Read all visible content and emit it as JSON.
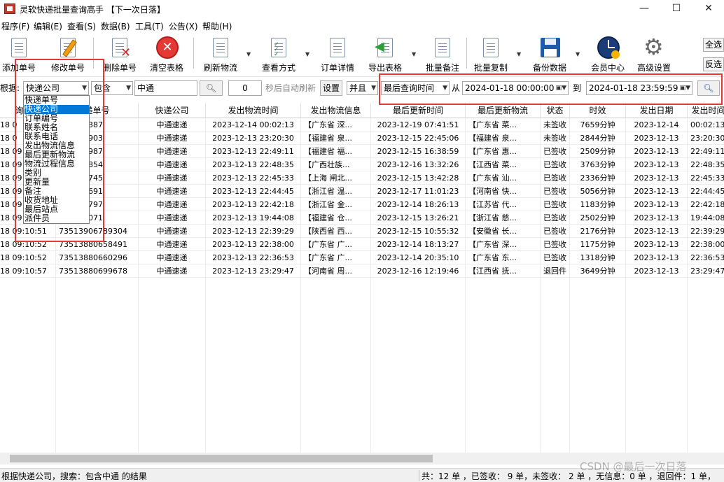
{
  "window": {
    "title": "灵软快递批量查询高手 【下一次日落】",
    "min_glyph": "—",
    "max_glyph": "☐",
    "close_glyph": "✕"
  },
  "menu": [
    "程序(F)",
    "编辑(E)",
    "查看(S)",
    "数据(B)",
    "工具(T)",
    "公告(X)",
    "帮助(H)"
  ],
  "toolbar": {
    "add": "添加单号",
    "edit": "修改单号",
    "delete": "删除单号",
    "clear": "清空表格",
    "refresh": "刷新物流",
    "view_mode": "查看方式",
    "order_detail": "订单详情",
    "export": "导出表格",
    "batch_note": "批量备注",
    "batch_copy": "批量复制",
    "backup": "备份数据",
    "member": "会员中心",
    "advanced": "高级设置",
    "select_all": "全选",
    "invert": "反选"
  },
  "filter": {
    "by_label": "根据:",
    "field_value": "快递公司",
    "op_value": "包含",
    "search_value": "中通",
    "search_icon": "magnifier-icon",
    "refresh_seconds": "0",
    "auto_refresh_label": "秒后自动刷新",
    "settings_label": "设置",
    "and_value": "并且",
    "time_field_value": "最后查询时间",
    "from_label": "从",
    "from_value": "2024-01-18 00:00:00",
    "to_label": "到",
    "to_value": "2024-01-18 23:59:59"
  },
  "dropdown_options": [
    "快递单号",
    "快递公司",
    "订单编号",
    "联系姓名",
    "联系电话",
    "发出物流信息",
    "最后更新物流",
    "物流过程信息",
    "类别",
    "更新量",
    "备注",
    "收货地址",
    "最后站点",
    "派件员"
  ],
  "dropdown_selected": 1,
  "columns": [
    "询时间",
    "递单号",
    "快递公司",
    "发出物流时间",
    "发出物流信息",
    "最后更新时间",
    "最后更新物流",
    "状态",
    "时效",
    "发出日期",
    "发出时间"
  ],
  "rows": [
    [
      "18 0",
      "880635387",
      "中通速递",
      "2023-12-14 00:02:13",
      "【广东省 深...",
      "2023-12-19 07:41:51",
      "【广东省 菜...",
      "未签收",
      "7659分钟",
      "2023-12-14",
      "00:02:13"
    ],
    [
      "18 0",
      "880671903",
      "中通速递",
      "2023-12-13 23:20:30",
      "【福建省 泉...",
      "2023-12-15 22:45:06",
      "【福建省 泉...",
      "未签收",
      "2844分钟",
      "2023-12-13",
      "23:20:30"
    ],
    [
      "18 09",
      "880676987",
      "中通速递",
      "2023-12-13 22:49:11",
      "【福建省 福...",
      "2023-12-15 16:38:59",
      "【广东省 惠...",
      "已签收",
      "2509分钟",
      "2023-12-13",
      "22:49:11"
    ],
    [
      "18 09",
      "906024854",
      "中通速递",
      "2023-12-13 22:48:35",
      "【广西壮族...",
      "2023-12-16 13:32:26",
      "【江西省 菜...",
      "已签收",
      "3763分钟",
      "2023-12-13",
      "22:48:35"
    ],
    [
      "18 09",
      "880689745",
      "中通速递",
      "2023-12-13 22:45:33",
      "【上海 闸北...",
      "2023-12-15 13:42:28",
      "【广东省 汕...",
      "已签收",
      "2336分钟",
      "2023-12-13",
      "22:45:33"
    ],
    [
      "18 09",
      "880694691",
      "中通速递",
      "2023-12-13 22:44:45",
      "【浙江省 温...",
      "2023-12-17 11:01:23",
      "【河南省 快...",
      "已签收",
      "5056分钟",
      "2023-12-13",
      "22:44:45"
    ],
    [
      "18 09",
      "906764797",
      "中通速递",
      "2023-12-13 22:42:18",
      "【浙江省 金...",
      "2023-12-14 18:26:13",
      "【江苏省 代...",
      "已签收",
      "1183分钟",
      "2023-12-13",
      "22:42:18"
    ],
    [
      "18 09",
      "880651071",
      "中通速递",
      "2023-12-13 19:44:08",
      "【福建省 仓...",
      "2023-12-15 13:26:21",
      "【浙江省 慈...",
      "已签收",
      "2502分钟",
      "2023-12-13",
      "19:44:08"
    ],
    [
      "18 09:10:51",
      "73513906789304",
      "中通速递",
      "2023-12-13 22:39:29",
      "【陕西省 西...",
      "2023-12-15 10:55:32",
      "【安徽省 长...",
      "已签收",
      "2176分钟",
      "2023-12-13",
      "22:39:29"
    ],
    [
      "18 09:10:52",
      "73513880658491",
      "中通速递",
      "2023-12-13 22:38:00",
      "【广东省 广...",
      "2023-12-14 18:13:27",
      "【广东省 深...",
      "已签收",
      "1175分钟",
      "2023-12-13",
      "22:38:00"
    ],
    [
      "18 09:10:52",
      "73513880660296",
      "中通速递",
      "2023-12-13 22:36:53",
      "【广东省 广...",
      "2023-12-14 20:35:10",
      "【广东省 东...",
      "已签收",
      "1318分钟",
      "2023-12-13",
      "22:36:53"
    ],
    [
      "18 09:10:57",
      "73513880699678",
      "中通速递",
      "2023-12-13 23:29:47",
      "【河南省 周...",
      "2023-12-16 12:19:46",
      "【江西省 抚...",
      "退回件",
      "3649分钟",
      "2023-12-13",
      "23:29:47"
    ]
  ],
  "status": {
    "left": "根据快递公司，搜索：包含中通 的结果",
    "right": "共：12 单 ，已签收： 9 单，未签收： 2 单 ，无信息：0 单 ，退回件：1 单，"
  },
  "watermark": "CSDN @最后一次日落"
}
